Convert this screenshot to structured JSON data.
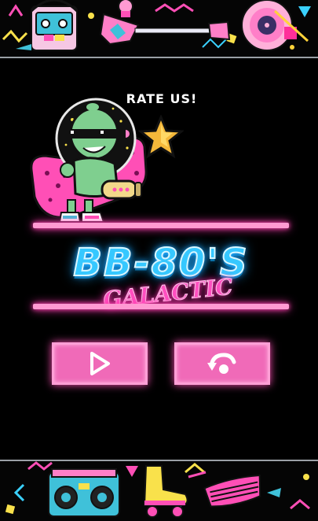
{
  "screen": "main-menu",
  "rate_us": {
    "label": "RATE US!"
  },
  "logo": {
    "title": "BB-80'S",
    "subtitle": "GALACTIC"
  },
  "buttons": {
    "play": {
      "icon": "play-icon"
    },
    "restart": {
      "icon": "restart-icon"
    }
  },
  "colors": {
    "background": "#000000",
    "neon_pink": "#ff4fb6",
    "button_fill": "#f06ab8",
    "logo_blue": "#36c8ff",
    "divider": "#9aa0a6"
  },
  "decorations": {
    "top": [
      "cassette-player-icon",
      "electric-guitar-icon",
      "vinyl-record-icon"
    ],
    "bottom": [
      "boombox-icon",
      "roller-skate-icon",
      "shutter-shades-icon"
    ]
  }
}
